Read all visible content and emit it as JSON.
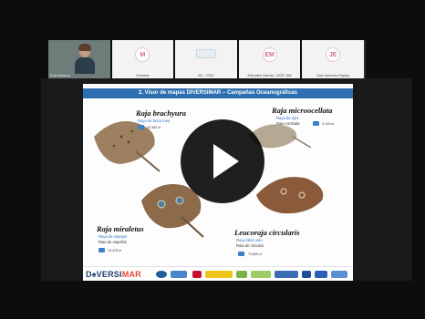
{
  "participants": [
    {
      "name": "Eva Velasco",
      "initial": "",
      "type": "video"
    },
    {
      "name": "Vicemar",
      "initial": "M",
      "type": "avatar"
    },
    {
      "name": "IM - CSIC",
      "initial": "",
      "type": "image"
    },
    {
      "name": "Estrelles Garcia - DGP, MA",
      "initial": "EM",
      "type": "avatar"
    },
    {
      "name": "Juan Antonio Espejo",
      "initial": "JE",
      "type": "avatar"
    }
  ],
  "slide": {
    "title": "2. Visor de mapas DIVERSIMAR – Campañas Oceanográficas",
    "species": [
      {
        "latin": "Raja brachyura",
        "common": "Raya de boca rosa",
        "common2": "",
        "depth": "10-380 m"
      },
      {
        "latin": "Raja microocellata",
        "common": "Raya de ojos",
        "common2": "Raia corisada",
        "depth": "0-100 m"
      },
      {
        "latin": "Raja miraletus",
        "common": "Raya de espejos",
        "common2": "Raia de espellos",
        "depth": "10-475 m"
      },
      {
        "latin": "Leucoraja circularis",
        "common": "Raya falso velo",
        "common2": "Raia de círculos",
        "depth": "70-800 m"
      }
    ],
    "brand_main": "D♠VERSI",
    "brand_accent": "MAR"
  },
  "colors": {
    "title_bar": "#2d6fb0",
    "common_name": "#2a73c9",
    "brand": "#1d3f6e",
    "brand_accent": "#e84b37"
  },
  "player": {
    "play_icon": "play-icon"
  }
}
